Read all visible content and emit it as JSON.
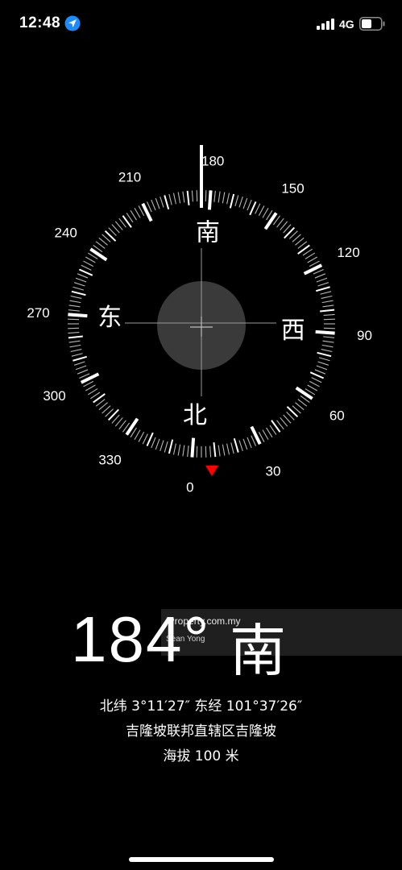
{
  "status_bar": {
    "time": "12:48",
    "network": "4G",
    "icons": [
      "location-arrow-icon",
      "cellular-signal-icon",
      "battery-icon"
    ]
  },
  "compass": {
    "degree_labels": [
      "180",
      "210",
      "240",
      "270",
      "300",
      "330",
      "0",
      "30",
      "60",
      "90",
      "120",
      "150"
    ],
    "cardinal_labels": {
      "south": "南",
      "west": "西",
      "north": "北",
      "east": "东"
    },
    "heading_degrees": 184,
    "accent_color": "#ff0000"
  },
  "watermark": {
    "site": "iProperty.com.my",
    "author": "Sean Yong"
  },
  "reading": {
    "degrees": "184°",
    "direction": "南",
    "coordinates": "北纬 3°11′27″  东经 101°37′26″",
    "place": "吉隆坡联邦直辖区吉隆坡",
    "altitude": "海拔 100 米"
  }
}
